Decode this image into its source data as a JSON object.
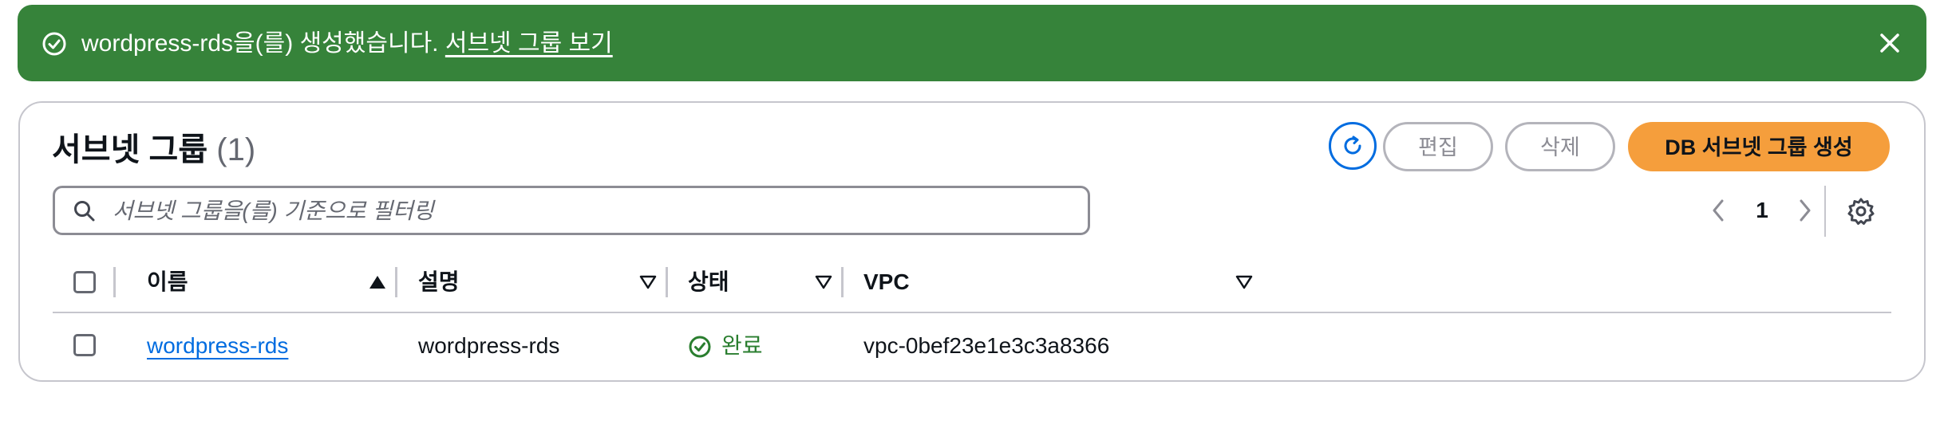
{
  "flash": {
    "message": "wordpress-rds을(를) 생성했습니다.",
    "link": "서브넷 그룹 보기",
    "icon": "check-circle-icon",
    "color": "#36833a"
  },
  "panel": {
    "title": "서브넷 그룹",
    "count": "(1)"
  },
  "actions": {
    "edit_label": "편집",
    "delete_label": "삭제",
    "create_label": "DB 서브넷 그룹 생성",
    "primary_color": "#f59e3c"
  },
  "filter": {
    "placeholder": "서브넷 그룹을(를) 기준으로 필터링"
  },
  "pagination": {
    "current_page": "1"
  },
  "table": {
    "columns": [
      {
        "label": "이름",
        "sort": "ascending"
      },
      {
        "label": "설명",
        "sort": "none"
      },
      {
        "label": "상태",
        "sort": "none"
      },
      {
        "label": "VPC",
        "sort": "none"
      }
    ],
    "rows": [
      {
        "name": "wordpress-rds",
        "description": "wordpress-rds",
        "status": "완료",
        "vpc": "vpc-0bef23e1e3c3a8366"
      }
    ]
  }
}
